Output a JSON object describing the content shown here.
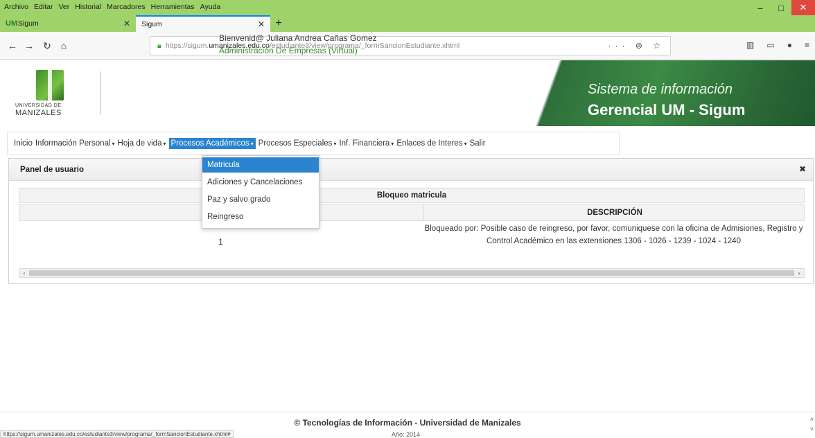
{
  "browser": {
    "menu": [
      "Archivo",
      "Editar",
      "Ver",
      "Historial",
      "Marcadores",
      "Herramientas",
      "Ayuda"
    ],
    "tabs": [
      {
        "title": "Sigum",
        "favicon": "UM"
      },
      {
        "title": "Sigum"
      }
    ],
    "new_tab": "+",
    "url_prefix": "https://sigum.",
    "url_host": "umanizales.edu.co",
    "url_path": "/estudiante3/view/programa/_formSancionEstudiante.xhtml",
    "url_actions": "··· ⊚ ☆",
    "window_controls": {
      "minimize": "–",
      "maximize": "□",
      "close": "✕"
    }
  },
  "header": {
    "logo_line1": "UNIVERSIDAD DE",
    "logo_line2": "MANIZALES",
    "welcome": "Bienvenid@ Juliana Andrea Cañas Gomez",
    "program": "Administración De Empresas (Virtual)",
    "banner_line1": "Sistema de información",
    "banner_line2": "Gerencial UM - Sigum"
  },
  "menu": [
    {
      "label": "Inicio",
      "caret": ""
    },
    {
      "label": "Información Personal",
      "caret": "▾"
    },
    {
      "label": "Hoja de vida",
      "caret": "▾"
    },
    {
      "label": "Procesos Académicos",
      "caret": "▾"
    },
    {
      "label": "Procesos Especiales",
      "caret": "▾"
    },
    {
      "label": "Inf. Financiera",
      "caret": "▾"
    },
    {
      "label": "Enlaces de Interes",
      "caret": "▾"
    },
    {
      "label": "Salir",
      "caret": ""
    }
  ],
  "dropdown": {
    "items": [
      "Matricula",
      "Adiciones y Cancelaciones",
      "Paz y salvo grado",
      "Reingreso"
    ],
    "selected": "Matricula"
  },
  "panel": {
    "title": "Panel de usuario",
    "close": "✖",
    "caption": "Bloqueo matricula",
    "column_desc": "DESCRIPCIÓN",
    "row_num": "1",
    "row_desc": "Bloqueado por: Posible caso de reingreso, por favor, comuniquese con la oficina de Admisiones, Registro y Control Académico en las extensiones 1306 - 1026 - 1239 - 1024 - 1240"
  },
  "footer": {
    "text": "© Tecnologías de Información - Universidad de Manizales",
    "year": "Año: 2014",
    "status_url": "https://sigum.umanizales.edu.co/estudiante3/view/programa/_formSancionEstudiante.xhtml#"
  }
}
